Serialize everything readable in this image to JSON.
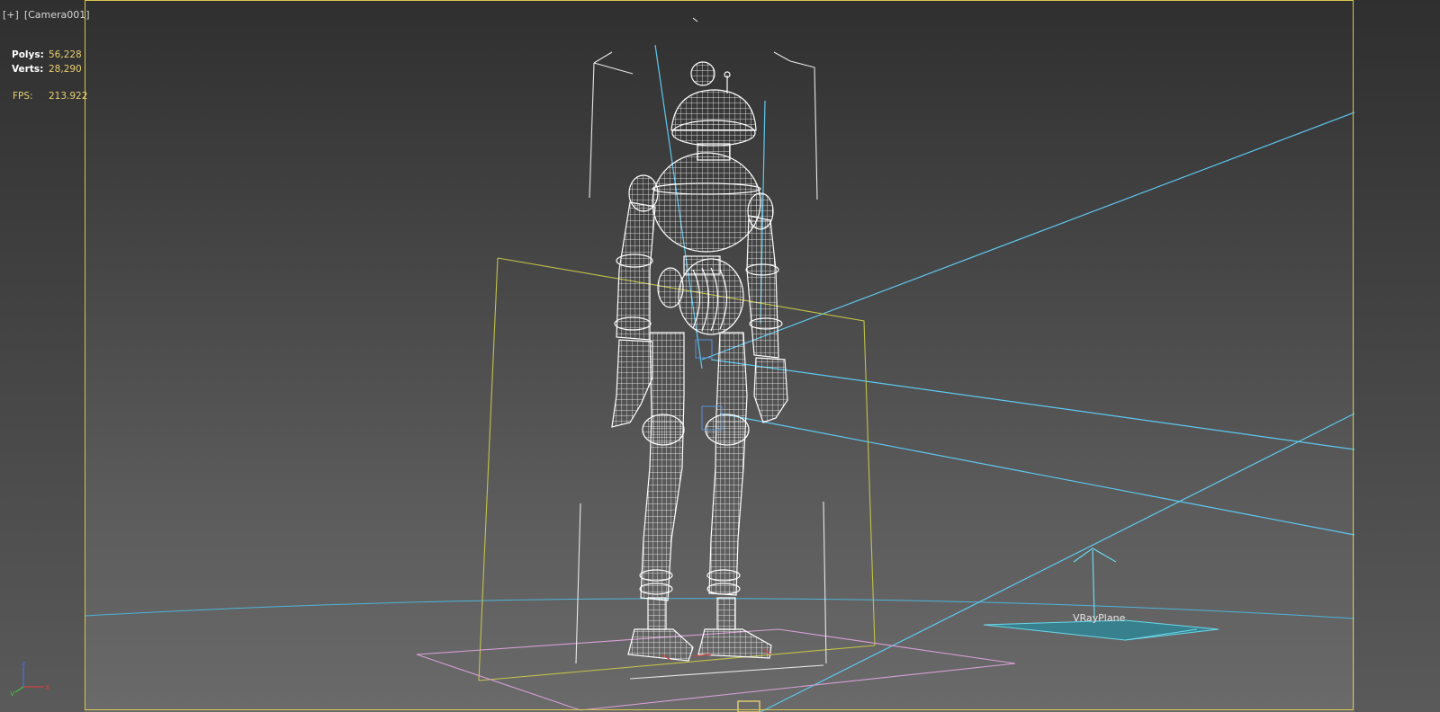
{
  "viewport": {
    "menu_label": "[+]",
    "camera_label": "[Camera001]"
  },
  "stats": {
    "polys_label": "Polys:",
    "polys_value": "56,228",
    "verts_label": "Verts:",
    "verts_value": "28,290",
    "fps_label": "FPS:",
    "fps_value": "213.922"
  },
  "scene": {
    "vray_plane_label": "VRayPlane"
  },
  "colors": {
    "frame_border": "#d8c84a",
    "stat_value": "#e8d070",
    "wireframe": "#ffffff",
    "light_lines": "#5ec8f0",
    "selection_box": "#c8c84a",
    "ground_plane": "#d8a0d8",
    "vray_plane": "#2a8a9c"
  },
  "gizmo": {
    "x_label": "x",
    "y_label": "y",
    "z_label": "z"
  }
}
